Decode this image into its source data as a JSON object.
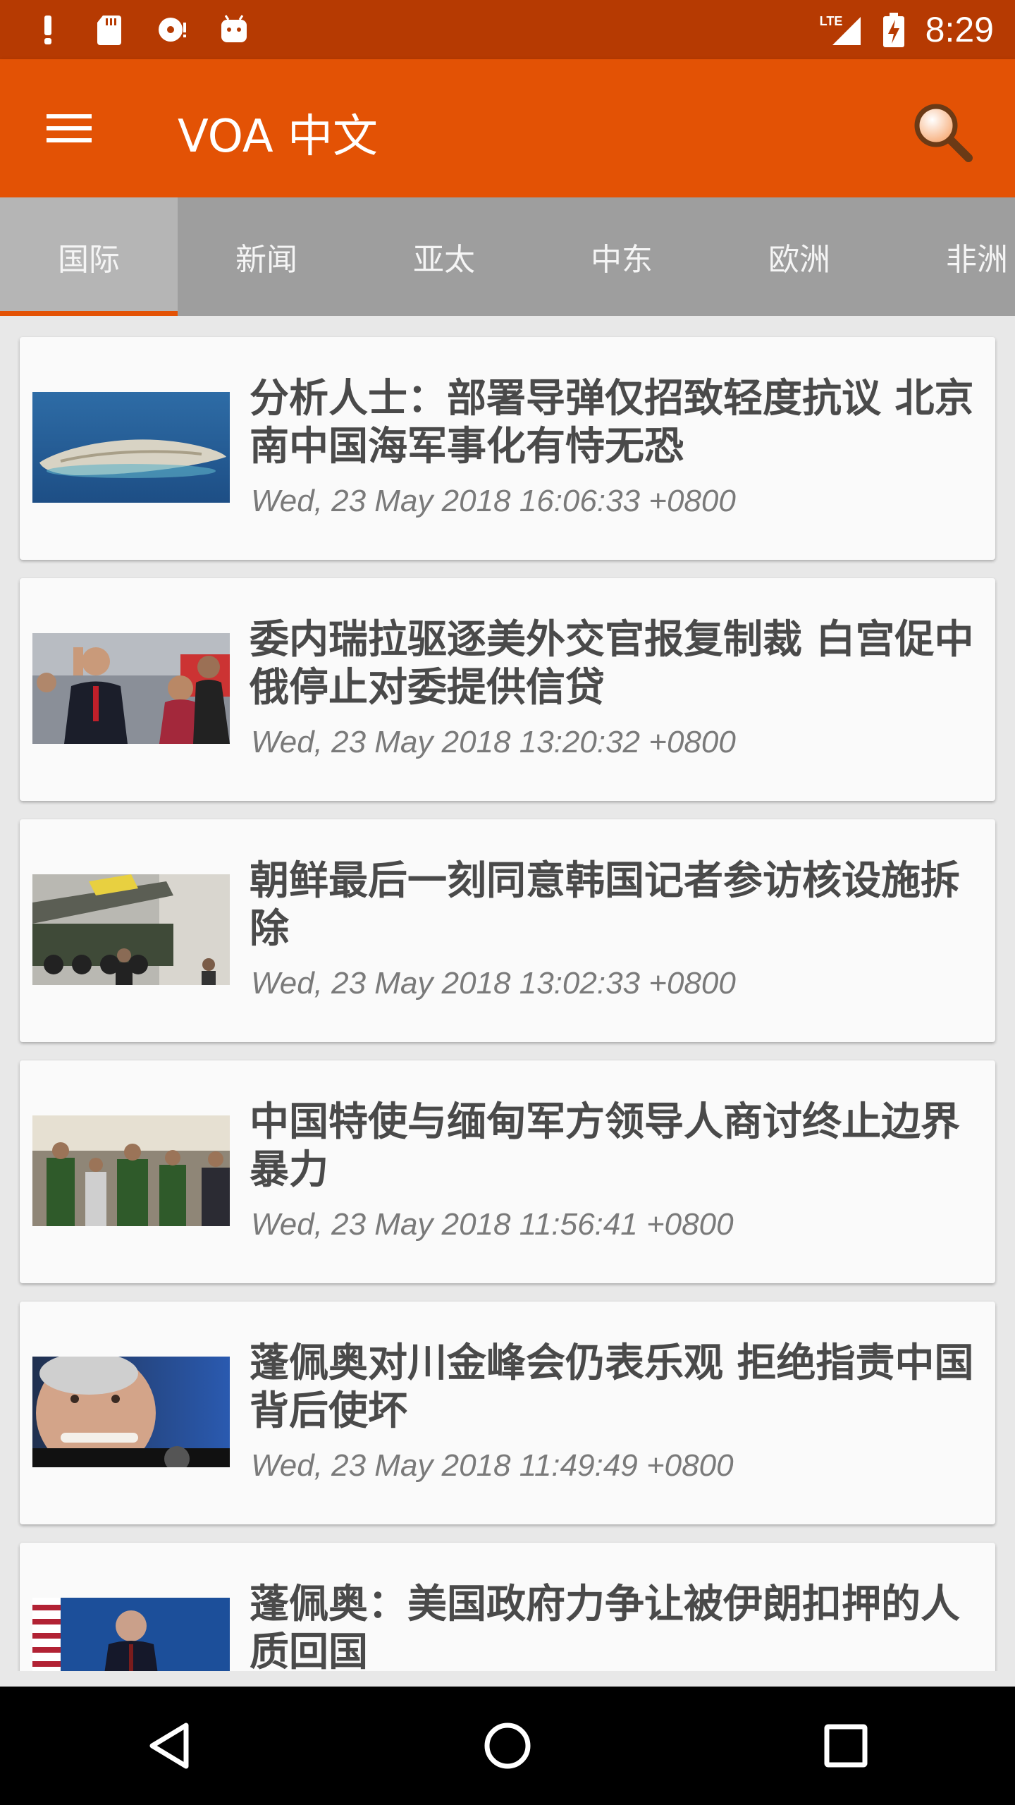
{
  "status_bar": {
    "time": "8:29",
    "network_label": "LTE",
    "left_icons": [
      "alert-icon",
      "sd-card-icon",
      "disc-icon",
      "android-icon"
    ],
    "right_icons": [
      "lte-signal-icon",
      "battery-charging-icon"
    ]
  },
  "app_bar": {
    "title": "VOA 中文",
    "menu_icon": "menu-icon",
    "search_icon": "search-icon",
    "color": "#e35205"
  },
  "tabs": [
    {
      "label": "国际",
      "active": true
    },
    {
      "label": "新闻",
      "active": false
    },
    {
      "label": "亚太",
      "active": false
    },
    {
      "label": "中东",
      "active": false
    },
    {
      "label": "欧洲",
      "active": false
    },
    {
      "label": "非洲",
      "active": false
    }
  ],
  "articles": [
    {
      "title": "分析人士：部署导弹仅招致轻度抗议 北京南中国海军事化有恃无恐",
      "date": "Wed, 23 May 2018 16:06:33 +0800"
    },
    {
      "title": "委内瑞拉驱逐美外交官报复制裁 白宫促中俄停止对委提供信贷",
      "date": "Wed, 23 May 2018 13:20:32 +0800"
    },
    {
      "title": "朝鲜最后一刻同意韩国记者参访核设施拆除",
      "date": "Wed, 23 May 2018 13:02:33 +0800"
    },
    {
      "title": "中国特使与缅甸军方领导人商讨终止边界暴力",
      "date": "Wed, 23 May 2018 11:56:41 +0800"
    },
    {
      "title": "蓬佩奥对川金峰会仍表乐观 拒绝指责中国背后使坏",
      "date": "Wed, 23 May 2018 11:49:49 +0800"
    },
    {
      "title": "蓬佩奥：美国政府力争让被伊朗扣押的人质回国",
      "date": ""
    }
  ],
  "nav_bar": {
    "buttons": [
      "back-icon",
      "home-icon",
      "recents-icon"
    ]
  }
}
